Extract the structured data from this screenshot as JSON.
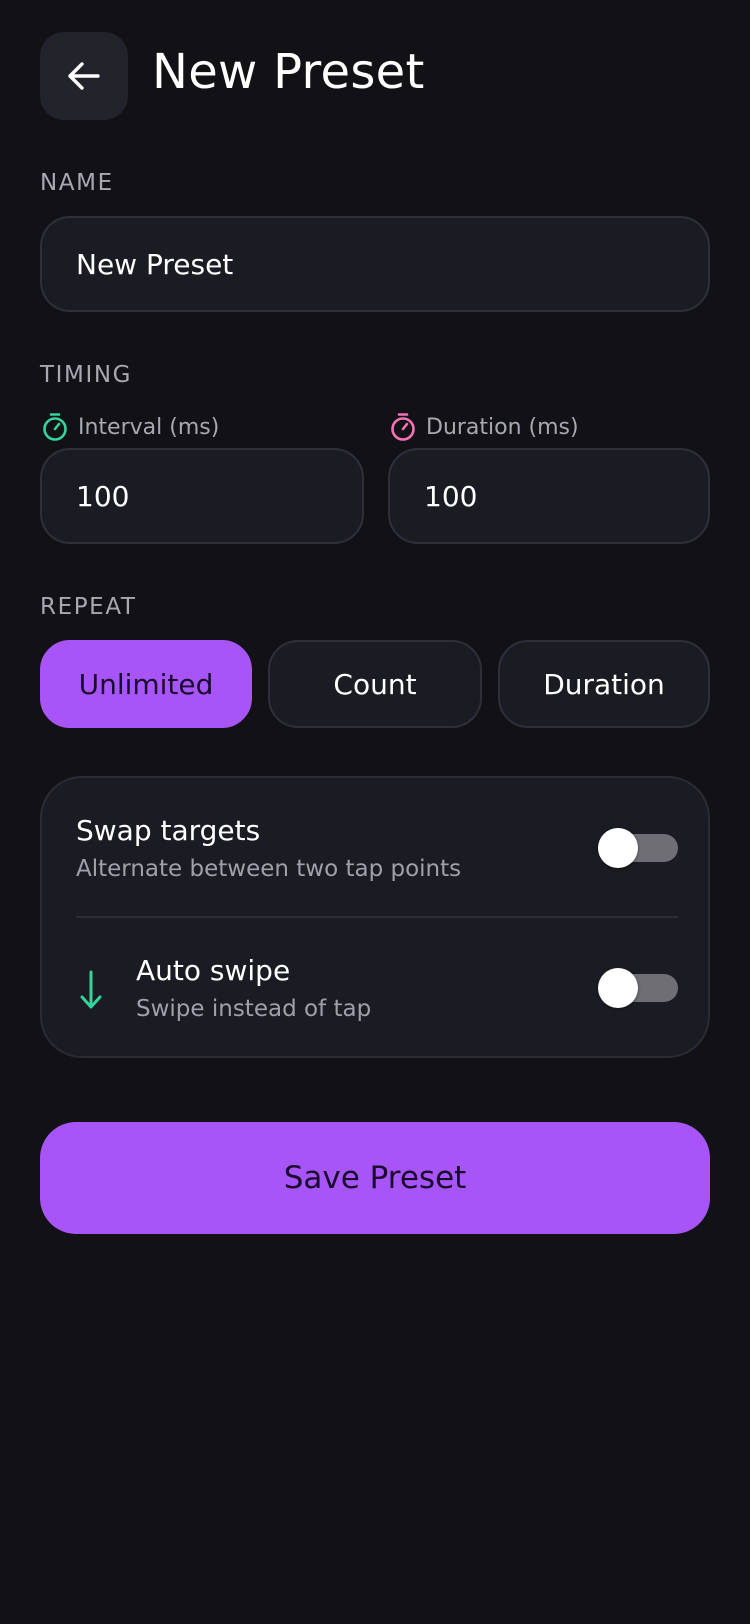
{
  "header": {
    "title": "New Preset",
    "back_icon": "arrow-left-icon"
  },
  "name_section": {
    "label": "NAME",
    "value": "New Preset"
  },
  "timing": {
    "label": "TIMING",
    "interval": {
      "label": "Interval (ms)",
      "value": "100",
      "icon": "stopwatch-icon",
      "color": "#34d399"
    },
    "duration": {
      "label": "Duration (ms)",
      "value": "100",
      "icon": "stopwatch-icon",
      "color": "#f472b6"
    }
  },
  "repeat": {
    "label": "REPEAT",
    "options": [
      "Unlimited",
      "Count",
      "Duration"
    ],
    "selected": "Unlimited"
  },
  "options": {
    "swap_targets": {
      "title": "Swap targets",
      "subtitle": "Alternate between two tap points",
      "enabled": false
    },
    "auto_swipe": {
      "title": "Auto swipe",
      "subtitle": "Swipe instead of tap",
      "enabled": false,
      "icon": "arrow-down-icon",
      "icon_color": "#34d399"
    }
  },
  "save_button": {
    "label": "Save Preset"
  },
  "colors": {
    "accent": "#a855f7",
    "background": "#111116",
    "surface": "#1b1c23"
  }
}
